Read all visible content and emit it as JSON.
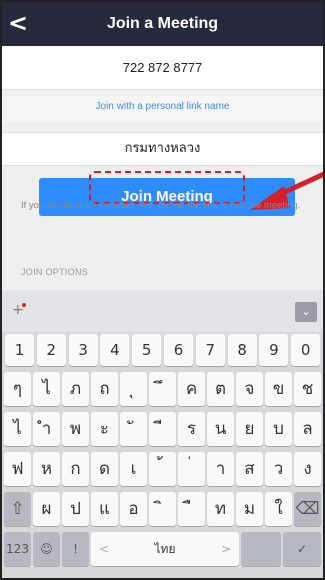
{
  "header": {
    "back_icon": "back-chevron-icon",
    "back_glyph": "<",
    "title": "Join a Meeting"
  },
  "meeting_id": "722 872 8777",
  "personal_link_label": "Join with a personal link name",
  "display_name": "กรมทางหลวง",
  "join_button_label": "Join Meeting",
  "hint_text": "If you received an invitation link, tap on the link to join the meeting.",
  "join_options_label": "JOIN OPTIONS",
  "keyboard": {
    "plus_glyph": "+",
    "collapse_glyph": "⌄",
    "numbers": [
      "1",
      "2",
      "3",
      "4",
      "5",
      "6",
      "7",
      "8",
      "9",
      "0"
    ],
    "row1": [
      "ๆ",
      "ไ",
      "ภ",
      "ถ",
      "ุ",
      "ึ",
      "ค",
      "ต",
      "จ",
      "ข",
      "ช"
    ],
    "row2": [
      "ไ",
      "ำ",
      "พ",
      "ะ",
      "ั",
      "ี",
      "ร",
      "น",
      "ย",
      "บ",
      "ล"
    ],
    "row3": [
      "ฟ",
      "ห",
      "ก",
      "ด",
      "เ",
      "้",
      "่",
      "า",
      "ส",
      "ว",
      "ง"
    ],
    "row4": [
      "ผ",
      "ป",
      "แ",
      "อ",
      "ิ",
      "ื",
      "ท",
      "ม",
      "ใ"
    ],
    "shift_glyph": "⇧",
    "delete_glyph": "⌫",
    "key_123": "123",
    "emoji_glyph": "☺",
    "mic_glyph": "!",
    "space_label": "ไทย",
    "space_left": "<",
    "space_right": ">",
    "done_glyph": "✓"
  },
  "colors": {
    "header_bg": "#272a3d",
    "accent_blue": "#2d8cff",
    "highlight_red": "#d4202a"
  }
}
